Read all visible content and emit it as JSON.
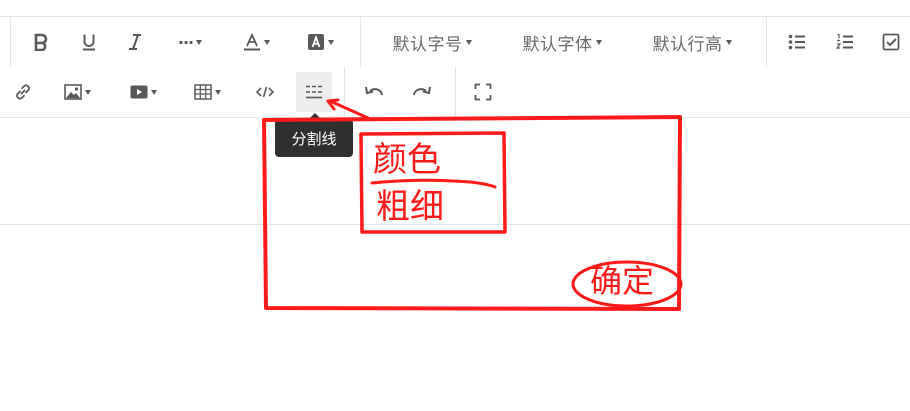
{
  "toolbar": {
    "row1": {
      "font_size_label": "默认字号",
      "font_family_label": "默认字体",
      "line_height_label": "默认行高",
      "more_label": "···"
    }
  },
  "tooltip": {
    "text": "分割线"
  },
  "annotation": {
    "color_label": "颜色",
    "thickness_label": "粗细",
    "confirm_label": "确定",
    "stroke_color": "#ff1a1a"
  }
}
